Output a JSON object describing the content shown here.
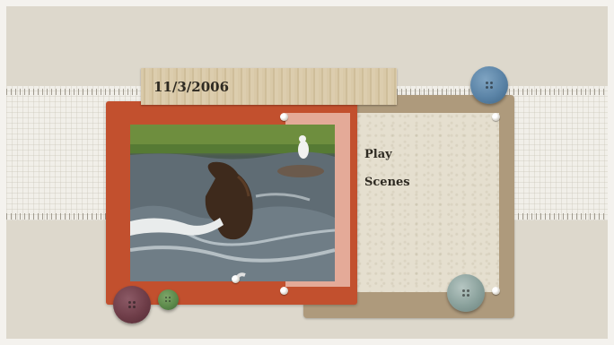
{
  "screen": {
    "date_label": "11/3/2006",
    "menu": [
      {
        "label": "Play"
      },
      {
        "label": "Scenes"
      }
    ]
  },
  "icons": [
    "blue-sewing-button-icon",
    "teal-sewing-button-icon",
    "maroon-sewing-button-icon",
    "green-sewing-button-icon",
    "pushpin-icon"
  ],
  "colors": {
    "background": "#ddd8cc",
    "red_frame": "#c2502e",
    "tan_card": "#ae9a7c",
    "paper_card": "#e5dfcf",
    "label_wood": "#d9c9a8",
    "text": "#2e2a22"
  }
}
